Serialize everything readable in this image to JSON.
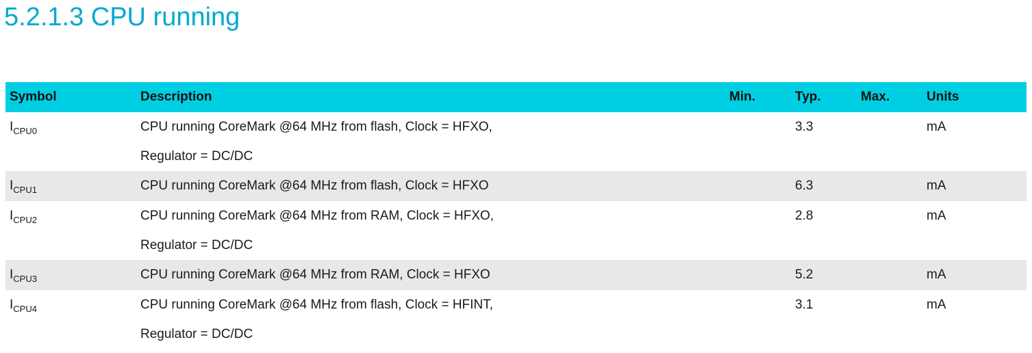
{
  "section": {
    "title": "5.2.1.3 CPU running"
  },
  "table": {
    "headers": {
      "symbol": "Symbol",
      "description": "Description",
      "min": "Min.",
      "typ": "Typ.",
      "max": "Max.",
      "units": "Units"
    },
    "colors": {
      "header_bg": "#00cfe3",
      "shaded_row_bg": "#e8e8e8",
      "title_color": "#00a9ce"
    },
    "rows": [
      {
        "symbol": {
          "base": "I",
          "sub": "CPU0"
        },
        "description": [
          "CPU running CoreMark @64 MHz from flash, Clock = HFXO,",
          "Regulator = DC/DC"
        ],
        "min": "",
        "typ": "3.3",
        "max": "",
        "units": "mA"
      },
      {
        "symbol": {
          "base": "I",
          "sub": "CPU1"
        },
        "description": [
          "CPU running CoreMark @64 MHz from flash, Clock = HFXO"
        ],
        "min": "",
        "typ": "6.3",
        "max": "",
        "units": "mA"
      },
      {
        "symbol": {
          "base": "I",
          "sub": "CPU2"
        },
        "description": [
          "CPU running CoreMark @64 MHz from RAM, Clock = HFXO,",
          "Regulator = DC/DC"
        ],
        "min": "",
        "typ": "2.8",
        "max": "",
        "units": "mA"
      },
      {
        "symbol": {
          "base": "I",
          "sub": "CPU3"
        },
        "description": [
          "CPU running CoreMark @64 MHz from RAM, Clock = HFXO"
        ],
        "min": "",
        "typ": "5.2",
        "max": "",
        "units": "mA"
      },
      {
        "symbol": {
          "base": "I",
          "sub": "CPU4"
        },
        "description": [
          "CPU running CoreMark @64 MHz from flash, Clock = HFINT,",
          "Regulator = DC/DC"
        ],
        "min": "",
        "typ": "3.1",
        "max": "",
        "units": "mA"
      }
    ]
  }
}
